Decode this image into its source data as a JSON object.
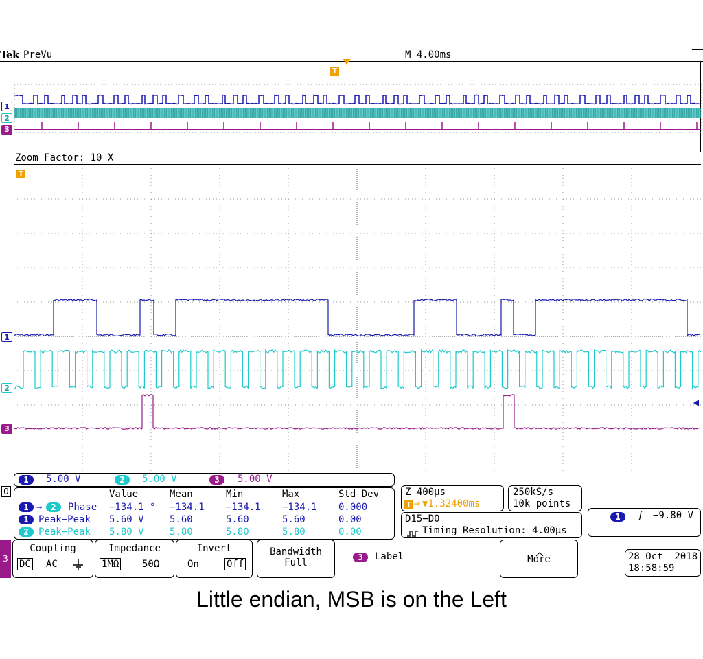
{
  "header": {
    "brand": "Tek",
    "mode": "PreVu",
    "timebase": "M 4.00ms"
  },
  "zoom": {
    "label": "Zoom Factor: 10 X"
  },
  "trigger_marker": "T",
  "channels": [
    {
      "num": "1",
      "color": "#1a1ab0",
      "scale": "5.00 V"
    },
    {
      "num": "2",
      "color": "#1fc9cc",
      "scale": "5.00 V"
    },
    {
      "num": "3",
      "color": "#9a1a8c",
      "scale": "5.00 V"
    }
  ],
  "ref_marker": "0",
  "side_marker": "3",
  "measurements": {
    "headers": [
      "Value",
      "Mean",
      "Min",
      "Max",
      "Std Dev"
    ],
    "rows": [
      {
        "src": "1",
        "src2": "2",
        "name": "Phase",
        "value": "−134.1 °",
        "mean": "−134.1",
        "min": "−134.1",
        "max": "−134.1",
        "std": "0.000"
      },
      {
        "src": "1",
        "name": "Peak−Peak",
        "value": "5.60 V",
        "mean": "5.60",
        "min": "5.60",
        "max": "5.60",
        "std": "0.00"
      },
      {
        "src": "2",
        "name": "Peak−Peak",
        "value": "5.80 V",
        "mean": "5.80",
        "min": "5.80",
        "max": "5.80",
        "std": "0.00"
      }
    ]
  },
  "zoom_info": {
    "zoom": "Z 400µs",
    "trigger_pos": "▼1.32400ms"
  },
  "sample": {
    "rate": "250kS/s",
    "points": "10k points"
  },
  "digital": {
    "bus": "D15−D0",
    "timing": "Timing Resolution: 4.00µs"
  },
  "trigger": {
    "source": "1",
    "slope": "ʃ",
    "level": "−9.80 V"
  },
  "menu": {
    "coupling": {
      "title": "Coupling",
      "options": [
        "DC",
        "AC"
      ]
    },
    "impedance": {
      "title": "Impedance",
      "options": [
        "1MΩ",
        "50Ω"
      ]
    },
    "invert": {
      "title": "Invert",
      "options": [
        "On",
        "Off"
      ]
    },
    "bandwidth": {
      "title": "Bandwidth",
      "value": "Full"
    },
    "label": {
      "num": "3",
      "text": "Label"
    },
    "more": {
      "text": "More"
    }
  },
  "datetime": {
    "date": "28 Oct  2018",
    "time": "18:58:59"
  },
  "caption": "Little endian, MSB is on the Left",
  "colors": {
    "ch1": "#1a1ab0",
    "ch2": "#1fc9cc",
    "ch3": "#9a1a8c",
    "trigger": "#f0a000",
    "overview_ch2": "#1a9a9a"
  }
}
